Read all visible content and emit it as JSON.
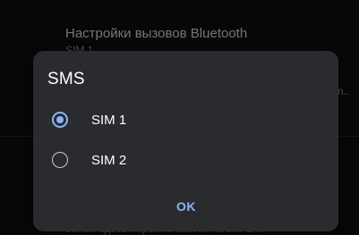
{
  "background": {
    "title": "Настройки вызовов Bluetooth",
    "subtitle": "SIM 1",
    "ellipsis": "n..",
    "bottom_text": "Зачем здесь переключаются на вот SIM"
  },
  "dialog": {
    "title": "SMS",
    "options": [
      {
        "label": "SIM 1",
        "selected": true
      },
      {
        "label": "SIM 2",
        "selected": false
      }
    ],
    "ok_label": "OK"
  },
  "colors": {
    "accent": "#8ab4f8",
    "dialog_bg": "#2a2b2f",
    "page_bg": "#0d0d0f"
  }
}
